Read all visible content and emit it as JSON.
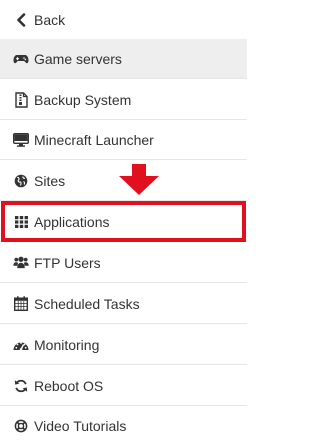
{
  "menu": {
    "items": [
      {
        "label": "Back",
        "icon": "chevron-left-icon"
      },
      {
        "label": "Game servers",
        "icon": "gamepad-icon"
      },
      {
        "label": "Backup System",
        "icon": "file-archive-icon"
      },
      {
        "label": "Minecraft Launcher",
        "icon": "desktop-icon"
      },
      {
        "label": "Sites",
        "icon": "globe-icon"
      },
      {
        "label": "Applications",
        "icon": "grid-icon"
      },
      {
        "label": "FTP Users",
        "icon": "users-icon"
      },
      {
        "label": "Scheduled Tasks",
        "icon": "calendar-icon"
      },
      {
        "label": "Monitoring",
        "icon": "dashboard-icon"
      },
      {
        "label": "Reboot OS",
        "icon": "refresh-icon"
      },
      {
        "label": "Video Tutorials",
        "icon": "lifebuoy-icon"
      }
    ],
    "active_item": "Game servers",
    "highlighted_item": "Applications"
  },
  "colors": {
    "highlight": "#e1101e",
    "active_background": "#eeeeee",
    "text": "#333333"
  }
}
